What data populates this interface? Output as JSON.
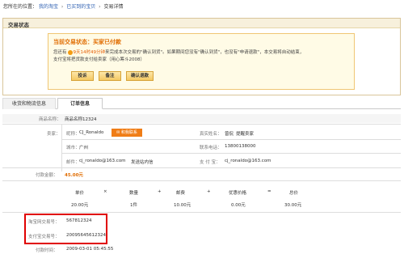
{
  "breadcrumb": {
    "prefix": "您所在的位置：",
    "items": [
      "我的淘宝",
      "已买到的宝贝"
    ],
    "current": "交易详情"
  },
  "status": {
    "header": "交易状态",
    "title": "当前交易状态：买家已付款",
    "line1_pre": "您还有",
    "countdown": "9天14时49分钟",
    "line1_post": "来完成本次交易的\"确认到货\"。如果期间您没有\"确认到货\"，也没有\"申请退款\"，本交易将自动结束，",
    "line2": "支付宝将把货款支付给卖家（用心筹斗2008）",
    "buttons": [
      "投诉",
      "备注",
      "确认退款"
    ]
  },
  "tabs": [
    "收货和物流信息",
    "订单信息"
  ],
  "order": {
    "product_label": "商品名称：",
    "product_value": "商品名称12324",
    "seller_label": "卖家：",
    "nickname_label": "昵称：",
    "nickname_value": "CJ_Ronaldo",
    "contact_btn": "和我联系",
    "realname_label": "真实姓名：",
    "realname_value": "曾侃",
    "realname_link": "提醒卖家",
    "city_label": "城市：",
    "city_value": "广州",
    "phone_label": "联系电话：",
    "phone_value": "13800138000",
    "email_label": "邮件：",
    "email_value": "cj_ronaldo@163.com",
    "send_msg": "发送站内信",
    "alipay_label": "支 付 宝：",
    "alipay_value": "cj_ronaldo@163.com",
    "amount_label": "付款金额：",
    "amount_value": "45.00元"
  },
  "calc": {
    "headers": [
      "单价",
      "数量",
      "邮费",
      "优惠价格",
      "总价"
    ],
    "ops": [
      "×",
      "+",
      "+",
      "="
    ],
    "values": [
      "20.00元",
      "1件",
      "10.00元",
      "0.00元",
      "30.00元"
    ]
  },
  "transactions": {
    "taobao_label": "淘宝网交易号：",
    "taobao_value": "567812324",
    "alipay_label": "支付宝交易号：",
    "alipay_value": "20095645612324",
    "time_label": "付款时间：",
    "time_value": "2009-03-01 05:45:55"
  }
}
